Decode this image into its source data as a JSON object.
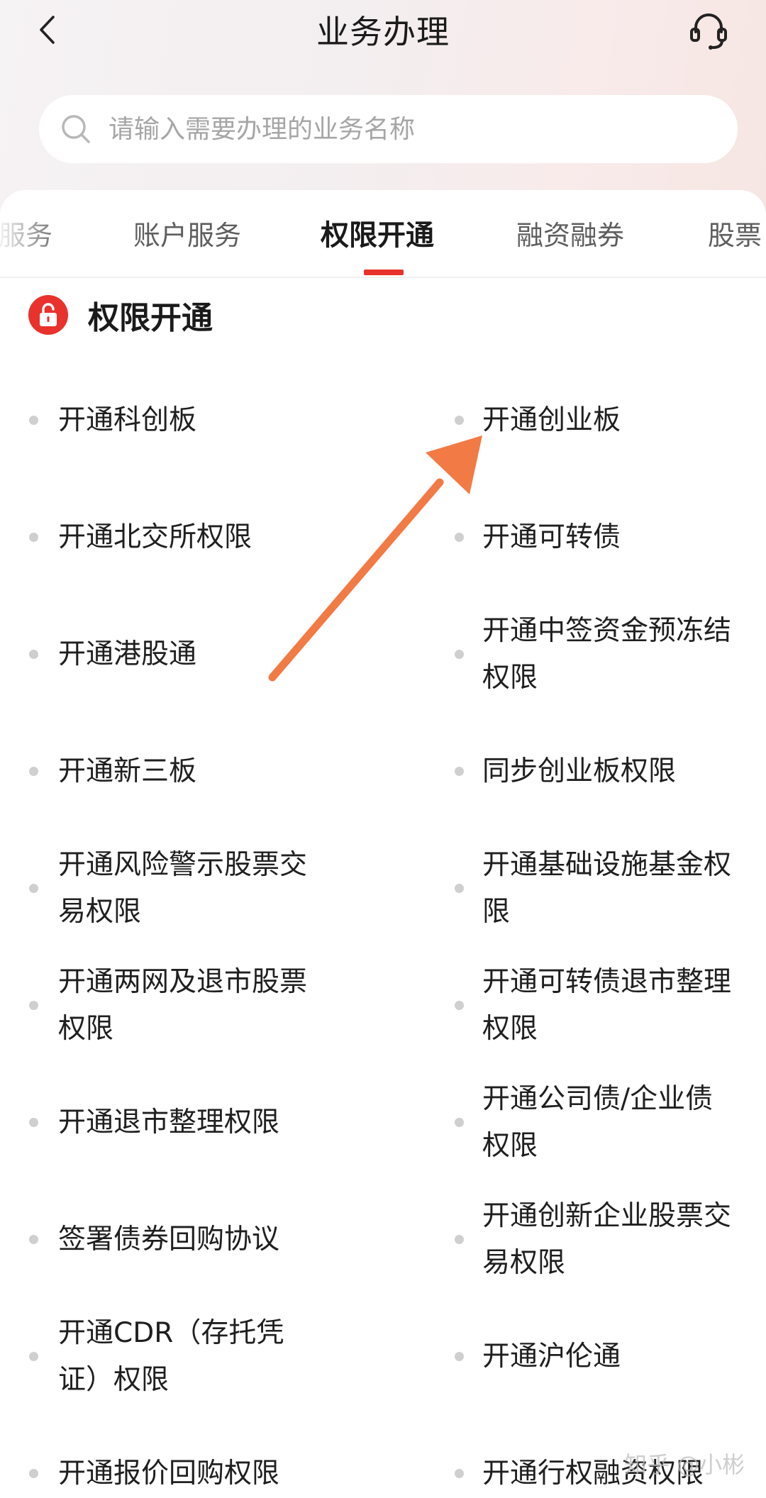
{
  "header": {
    "title": "业务办理",
    "back_icon": "chevron-left-icon",
    "service_icon": "headset-icon"
  },
  "search": {
    "placeholder": "请输入需要办理的业务名称",
    "icon": "search-icon"
  },
  "tabs": [
    {
      "label": "服务",
      "active": false
    },
    {
      "label": "账户服务",
      "active": false
    },
    {
      "label": "权限开通",
      "active": true
    },
    {
      "label": "融资融券",
      "active": false
    },
    {
      "label": "股票",
      "active": false
    }
  ],
  "section": {
    "title": "权限开通",
    "icon": "unlock-icon",
    "accent_color": "#e8322b"
  },
  "permissions": [
    "开通科创板",
    "开通创业板",
    "开通北交所权限",
    "开通可转债",
    "开通港股通",
    "开通中签资金预冻结权限",
    "开通新三板",
    "同步创业板权限",
    "开通风险警示股票交易权限",
    "开通基础设施基金权限",
    "开通两网及退市股票权限",
    "开通可转债退市整理权限",
    "开通退市整理权限",
    "开通公司债/企业债权限",
    "签署债券回购协议",
    "开通创新企业股票交易权限",
    "开通CDR（存托凭证）权限",
    "开通沪伦通",
    "开通报价回购权限",
    "开通行权融资权限"
  ],
  "annotation": {
    "arrow_color": "#f27a45",
    "target": "开通创业板"
  },
  "watermark": "知乎 @小彬"
}
